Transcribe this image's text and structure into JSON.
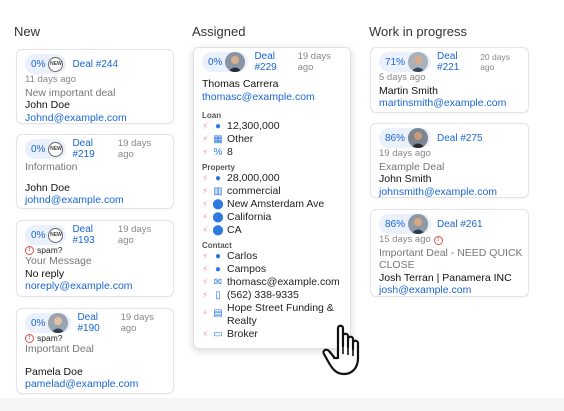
{
  "columns": [
    {
      "title": "New"
    },
    {
      "title": "Assigned"
    },
    {
      "title": "Work in progress"
    }
  ],
  "new_cards": [
    {
      "pct": "0%",
      "badge": "NEW",
      "deal": "Deal #244",
      "ago": "11 days ago",
      "title": "New important deal",
      "name": "John Doe",
      "email": "Johnd@example.com"
    },
    {
      "pct": "0%",
      "badge": "NEW",
      "deal": "Deal #219",
      "ago": "19 days ago",
      "title": "Information",
      "name": "John Doe",
      "email": "johnd@example.com"
    },
    {
      "pct": "0%",
      "badge": "NEW",
      "deal": "Deal #193",
      "ago": "19 days ago",
      "spam": "spam?",
      "title": "Your Message",
      "name": "No reply",
      "email": "noreply@example.com"
    },
    {
      "pct": "0%",
      "deal": "Deal #190",
      "ago": "19 days ago",
      "spam": "spam?",
      "title": "Important Deal",
      "name": "Pamela Doe",
      "email": "pamelad@example.com"
    }
  ],
  "assigned_card": {
    "pct": "0%",
    "deal": "Deal #229",
    "ago": "19 days ago",
    "name": "Thomas Carrera",
    "email": "thomasc@example.com",
    "loan_label": "Loan",
    "loan": [
      "12,300,000",
      "Other",
      "8"
    ],
    "property_label": "Property",
    "property": [
      "28,000,000",
      "commercial",
      "New Amsterdam Ave",
      "California",
      "CA"
    ],
    "contact_label": "Contact",
    "contact": [
      "Carlos",
      "Campos",
      "thomasc@example.com",
      "(562) 338-9335",
      "Hope Street Funding &",
      "Realty",
      "Broker"
    ]
  },
  "wip_cards": [
    {
      "pct": "71%",
      "deal": "Deal #221",
      "ago": "20 days ago",
      "ago_line": "5 days ago",
      "name": "Martin Smith",
      "email": "martinsmith@example.com"
    },
    {
      "pct": "86%",
      "deal": "Deal #275",
      "ago_line": "19 days ago",
      "title": "Example Deal",
      "name": "John Smith",
      "email": "johnsmith@example.com"
    },
    {
      "pct": "86%",
      "deal": "Deal #261",
      "ago_line": "15 days ago",
      "title": "Important Deal - NEED QUICK",
      "title2": "CLOSE",
      "name": "Josh Terran | Panamera INC",
      "email": "josh@example.com"
    }
  ]
}
